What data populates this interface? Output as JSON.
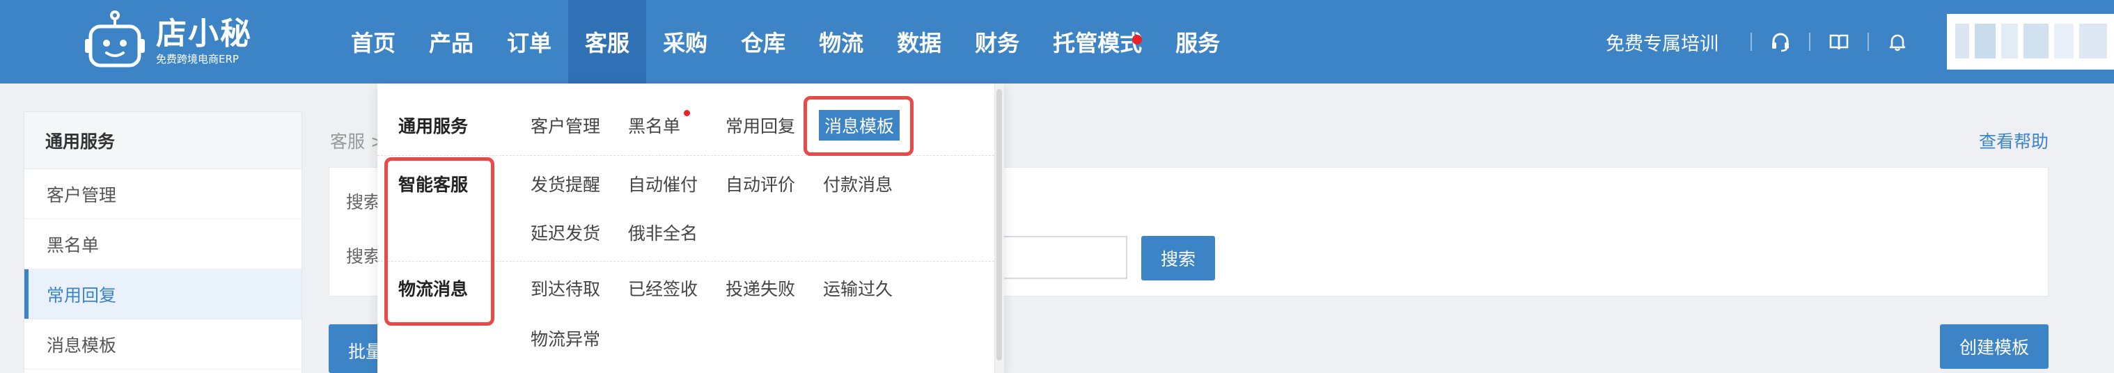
{
  "logo": {
    "name": "店小秘",
    "tagline": "免费跨境电商ERP"
  },
  "nav": {
    "items": [
      {
        "label": "首页"
      },
      {
        "label": "产品"
      },
      {
        "label": "订单"
      },
      {
        "label": "客服",
        "active": true
      },
      {
        "label": "采购"
      },
      {
        "label": "仓库"
      },
      {
        "label": "物流"
      },
      {
        "label": "数据"
      },
      {
        "label": "财务"
      },
      {
        "label": "托管模式",
        "badge": true
      },
      {
        "label": "服务"
      }
    ],
    "training_label": "免费专属培训",
    "icons": [
      "headset-icon",
      "book-icon",
      "bell-icon"
    ]
  },
  "sidebar": {
    "heading": "通用服务",
    "items": [
      {
        "label": "客户管理"
      },
      {
        "label": "黑名单"
      },
      {
        "label": "常用回复",
        "active": true
      },
      {
        "label": "消息模板"
      }
    ]
  },
  "main": {
    "breadcrumb": "客服 >",
    "help_link": "查看帮助",
    "search_label_1": "搜索",
    "search_label_2": "搜索",
    "search_button": "搜索",
    "batch_button": "批量",
    "create_button": "创建模板"
  },
  "dropdown": {
    "groups": [
      {
        "title": "通用服务",
        "links": [
          "客户管理",
          "黑名单",
          "常用回复",
          "消息模板"
        ]
      },
      {
        "title": "智能客服",
        "links": [
          "发货提醒",
          "自动催付",
          "自动评价",
          "付款消息",
          "延迟发货",
          "俄非全名"
        ]
      },
      {
        "title": "物流消息",
        "links": [
          "到达待取",
          "已经签收",
          "投递失败",
          "运输过久",
          "物流异常"
        ]
      }
    ],
    "selected_link": "消息模板"
  },
  "colors": {
    "brand": "#3d84c7",
    "nav_active": "#2f71b4",
    "highlight": "#e94949",
    "badge": "#e8212a"
  }
}
